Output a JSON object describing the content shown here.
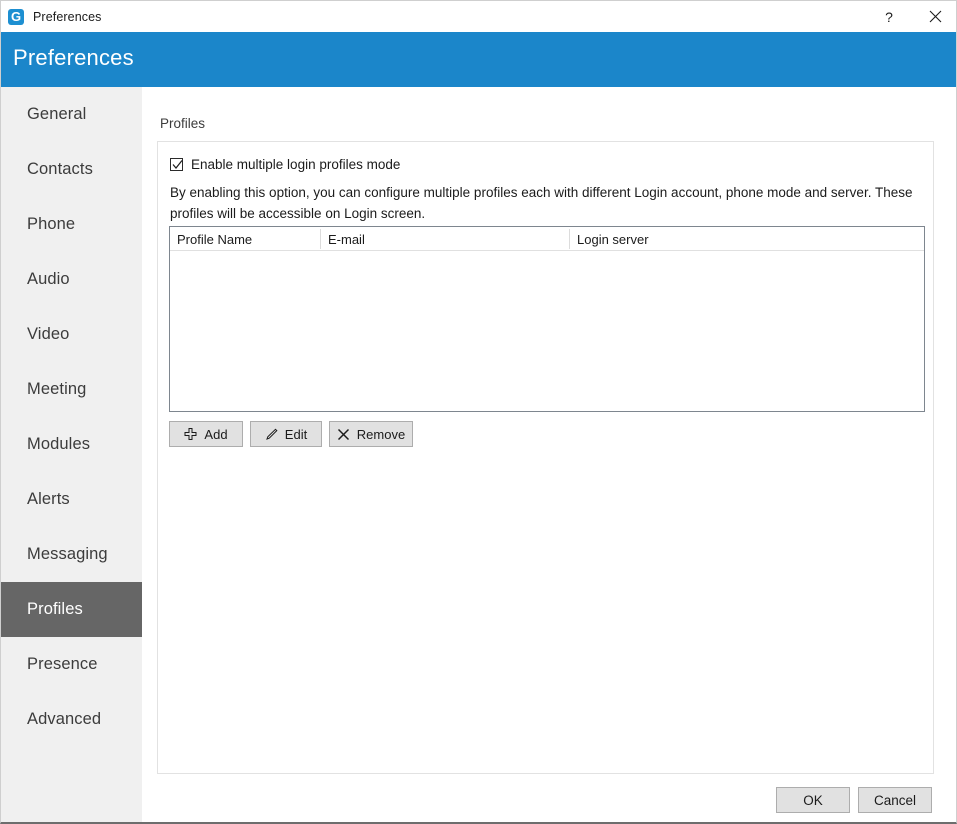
{
  "window": {
    "titlebar_text": "Preferences",
    "app_icon": "app-logo-icon",
    "help_glyph": "?",
    "help_icon": "help-icon",
    "close_icon": "close-icon"
  },
  "header": {
    "title": "Preferences",
    "accent_color": "#1b86ca"
  },
  "sidebar": {
    "selected": "Profiles",
    "selected_bg": "#666666",
    "background": "#f0f0f0",
    "items": [
      {
        "label": "General"
      },
      {
        "label": "Contacts"
      },
      {
        "label": "Phone"
      },
      {
        "label": "Audio"
      },
      {
        "label": "Video"
      },
      {
        "label": "Meeting"
      },
      {
        "label": "Modules"
      },
      {
        "label": "Alerts"
      },
      {
        "label": "Messaging"
      },
      {
        "label": "Profiles"
      },
      {
        "label": "Presence"
      },
      {
        "label": "Advanced"
      }
    ]
  },
  "main": {
    "section_label": "Profiles",
    "checkbox": {
      "label": "Enable multiple login profiles mode",
      "checked": true
    },
    "description": "By enabling this option, you can configure multiple profiles each with different Login account, phone mode and server. These profiles will be accessible on Login screen.",
    "table": {
      "columns": [
        "Profile Name",
        "E-mail",
        "Login server"
      ],
      "rows": []
    },
    "actions": [
      {
        "label": "Add",
        "icon": "plus-icon"
      },
      {
        "label": "Edit",
        "icon": "pencil-icon"
      },
      {
        "label": "Remove",
        "icon": "cross-icon"
      }
    ]
  },
  "footer": {
    "ok_label": "OK",
    "cancel_label": "Cancel"
  }
}
